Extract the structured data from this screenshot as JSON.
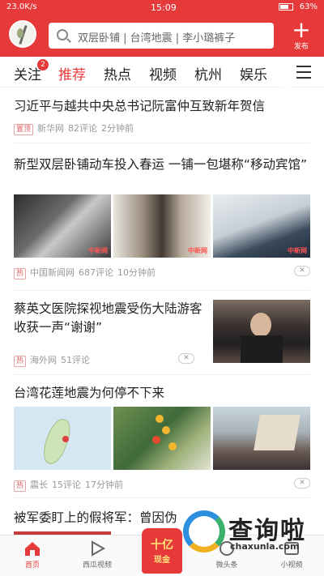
{
  "status": {
    "left": "23.0K/s",
    "time": "15:09",
    "battery": "63%"
  },
  "header": {
    "search_placeholder": "双层卧铺 | 台湾地震 | 李小璐裤子",
    "publish_label": "发布"
  },
  "tabs": [
    {
      "label": "关注",
      "badge": "2"
    },
    {
      "label": "推荐"
    },
    {
      "label": "热点"
    },
    {
      "label": "视频"
    },
    {
      "label": "杭州"
    },
    {
      "label": "娱乐"
    }
  ],
  "articles": [
    {
      "title": "习近平与越共中央总书记阮富仲互致新年贺信",
      "tag": "置顶",
      "source": "新华网",
      "comments": "82评论",
      "time": "2分钟前"
    },
    {
      "title": "新型双层卧铺动车投入春运 一铺一包堪称“移动宾馆”",
      "tag": "热",
      "source": "中国新闻网",
      "comments": "687评论",
      "time": "10分钟前",
      "watermark": "中新网"
    },
    {
      "title": "蔡英文医院探视地震受伤大陆游客 收获一声“谢谢”",
      "tag": "热",
      "source": "海外网",
      "comments": "51评论"
    },
    {
      "title": "台湾花莲地震为何停不下来",
      "tag": "热",
      "source": "震长",
      "comments": "15评论",
      "time": "17分钟前"
    },
    {
      "title": "被军委盯上的假将军：曾因伪"
    }
  ],
  "bottom_nav": {
    "home": "首页",
    "video": "西瓜视频",
    "center_big": "十亿",
    "center_small": "现金",
    "micro": "微头条",
    "small_video": "小视频"
  },
  "site_watermark": {
    "text": "查询啦",
    "url": "chaxunla.com"
  },
  "colors": {
    "brand": "#e63a3a",
    "text": "#222222",
    "meta": "#999999"
  }
}
